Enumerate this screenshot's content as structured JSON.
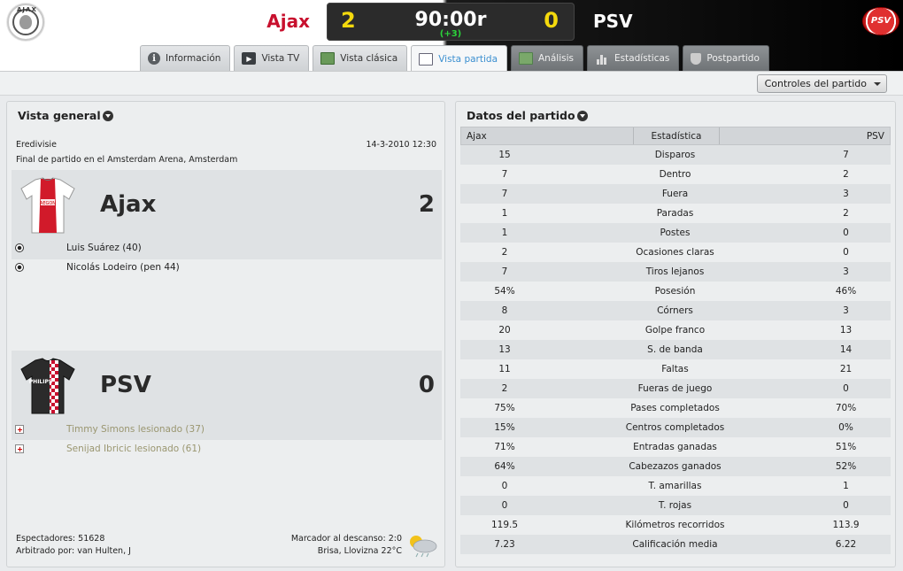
{
  "header": {
    "home_team": "Ajax",
    "away_team": "PSV",
    "home_score": "2",
    "away_score": "0",
    "clock": "90:00r",
    "added_time": "(+3)",
    "home_logo_text": "AJAX",
    "away_logo_text": "PSV",
    "colors": {
      "home": "#c8102e",
      "score": "#f4d90d",
      "added": "#2bd23a",
      "active_tab": "#3b8fd0"
    }
  },
  "tabs": [
    {
      "label": "Información",
      "icon": "info-icon"
    },
    {
      "label": "Vista TV",
      "icon": "tv-icon"
    },
    {
      "label": "Vista clásica",
      "icon": "pitch-icon"
    },
    {
      "label": "Vista partida",
      "icon": "list-icon"
    },
    {
      "label": "Análisis",
      "icon": "analysis-icon"
    },
    {
      "label": "Estadísticas",
      "icon": "bars-icon"
    },
    {
      "label": "Postpartido",
      "icon": "shield-icon"
    }
  ],
  "toolbar": {
    "controls_label": "Controles del partido"
  },
  "overview": {
    "title": "Vista general",
    "competition": "Eredivisie",
    "date": "14-3-2010 12:30",
    "venue": "Final de partido en el Amsterdam Arena, Amsterdam",
    "home": {
      "name": "Ajax",
      "score": "2",
      "events": [
        {
          "type": "goal",
          "text": "Luis Suárez (40)"
        },
        {
          "type": "goal",
          "text": "Nicolás Lodeiro (pen 44)"
        }
      ]
    },
    "away": {
      "name": "PSV",
      "score": "0",
      "events": [
        {
          "type": "injury",
          "text": "Timmy Simons lesionado (37)"
        },
        {
          "type": "injury",
          "text": "Senijad Ibricic lesionado (61)"
        }
      ]
    },
    "attendance": "Espectadores: 51628",
    "referee": "Arbitrado por: van Hulten, J",
    "halftime": "Marcador al descanso: 2:0",
    "weather": "Brisa, Llovizna 22°C",
    "home_shirt_text": "AEGON",
    "away_shirt_text": "PHILIPS"
  },
  "matchdata": {
    "title": "Datos del partido",
    "columns": {
      "home": "Ajax",
      "label": "Estadística",
      "away": "PSV"
    },
    "rows": [
      {
        "home": "15",
        "label": "Disparos",
        "away": "7"
      },
      {
        "home": "7",
        "label": "Dentro",
        "away": "2"
      },
      {
        "home": "7",
        "label": "Fuera",
        "away": "3"
      },
      {
        "home": "1",
        "label": "Paradas",
        "away": "2"
      },
      {
        "home": "1",
        "label": "Postes",
        "away": "0"
      },
      {
        "home": "2",
        "label": "Ocasiones claras",
        "away": "0"
      },
      {
        "home": "7",
        "label": "Tiros lejanos",
        "away": "3"
      },
      {
        "home": "54%",
        "label": "Posesión",
        "away": "46%"
      },
      {
        "home": "8",
        "label": "Córners",
        "away": "3"
      },
      {
        "home": "20",
        "label": "Golpe franco",
        "away": "13"
      },
      {
        "home": "13",
        "label": "S. de banda",
        "away": "14"
      },
      {
        "home": "11",
        "label": "Faltas",
        "away": "21"
      },
      {
        "home": "2",
        "label": "Fueras de juego",
        "away": "0"
      },
      {
        "home": "75%",
        "label": "Pases completados",
        "away": "70%"
      },
      {
        "home": "15%",
        "label": "Centros completados",
        "away": "0%"
      },
      {
        "home": "71%",
        "label": "Entradas ganadas",
        "away": "51%"
      },
      {
        "home": "64%",
        "label": "Cabezazos ganados",
        "away": "52%"
      },
      {
        "home": "0",
        "label": "T. amarillas",
        "away": "1"
      },
      {
        "home": "0",
        "label": "T. rojas",
        "away": "0"
      },
      {
        "home": "119.5",
        "label": "Kilómetros recorridos",
        "away": "113.9"
      },
      {
        "home": "7.23",
        "label": "Calificación media",
        "away": "6.22"
      }
    ]
  }
}
